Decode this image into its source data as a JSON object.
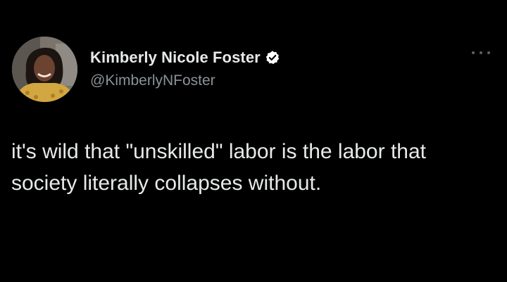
{
  "tweet": {
    "author": {
      "display_name": "Kimberly Nicole Foster",
      "handle": "@KimberlyNFoster",
      "verified": true
    },
    "text": "it's wild that \"unskilled\" labor is the labor that society literally collapses without.",
    "colors": {
      "background": "#000000",
      "primary_text": "#e7e9ea",
      "secondary_text": "#8b9199",
      "verified_badge": "#ffffff"
    },
    "icons": {
      "verified": "verified-badge-icon",
      "more": "more-options-icon"
    }
  }
}
